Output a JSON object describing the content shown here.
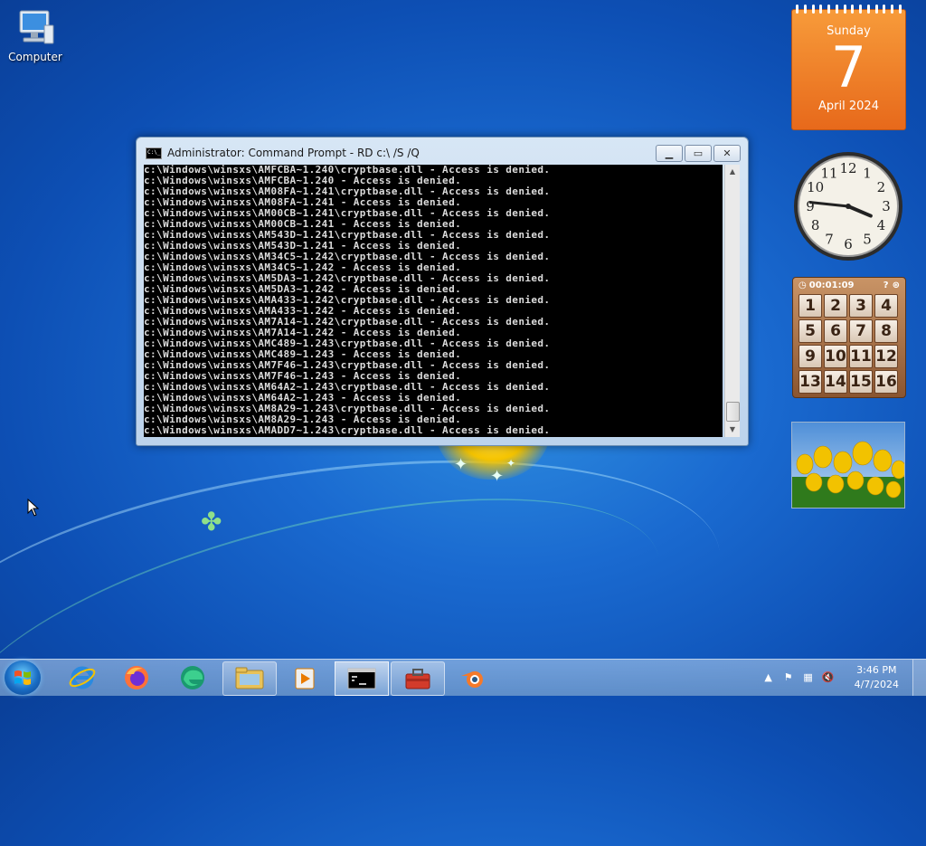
{
  "desktop": {
    "icons": [
      {
        "label": "Computer",
        "icon": "computer-icon"
      }
    ]
  },
  "cmd_window": {
    "title": "Administrator:  Command Prompt - RD  c:\\ /S /Q",
    "buttons": [
      "minimize",
      "maximize",
      "close"
    ],
    "lines": [
      "c:\\Windows\\winsxs\\AMFCBA~1.240\\cryptbase.dll - Access is denied.",
      "c:\\Windows\\winsxs\\AMFCBA~1.240 - Access is denied.",
      "c:\\Windows\\winsxs\\AM08FA~1.241\\cryptbase.dll - Access is denied.",
      "c:\\Windows\\winsxs\\AM08FA~1.241 - Access is denied.",
      "c:\\Windows\\winsxs\\AM00CB~1.241\\cryptbase.dll - Access is denied.",
      "c:\\Windows\\winsxs\\AM00CB~1.241 - Access is denied.",
      "c:\\Windows\\winsxs\\AM543D~1.241\\cryptbase.dll - Access is denied.",
      "c:\\Windows\\winsxs\\AM543D~1.241 - Access is denied.",
      "c:\\Windows\\winsxs\\AM34C5~1.242\\cryptbase.dll - Access is denied.",
      "c:\\Windows\\winsxs\\AM34C5~1.242 - Access is denied.",
      "c:\\Windows\\winsxs\\AM5DA3~1.242\\cryptbase.dll - Access is denied.",
      "c:\\Windows\\winsxs\\AM5DA3~1.242 - Access is denied.",
      "c:\\Windows\\winsxs\\AMA433~1.242\\cryptbase.dll - Access is denied.",
      "c:\\Windows\\winsxs\\AMA433~1.242 - Access is denied.",
      "c:\\Windows\\winsxs\\AM7A14~1.242\\cryptbase.dll - Access is denied.",
      "c:\\Windows\\winsxs\\AM7A14~1.242 - Access is denied.",
      "c:\\Windows\\winsxs\\AMC489~1.243\\cryptbase.dll - Access is denied.",
      "c:\\Windows\\winsxs\\AMC489~1.243 - Access is denied.",
      "c:\\Windows\\winsxs\\AM7F46~1.243\\cryptbase.dll - Access is denied.",
      "c:\\Windows\\winsxs\\AM7F46~1.243 - Access is denied.",
      "c:\\Windows\\winsxs\\AM64A2~1.243\\cryptbase.dll - Access is denied.",
      "c:\\Windows\\winsxs\\AM64A2~1.243 - Access is denied.",
      "c:\\Windows\\winsxs\\AM8A29~1.243\\cryptbase.dll - Access is denied.",
      "c:\\Windows\\winsxs\\AM8A29~1.243 - Access is denied.",
      "c:\\Windows\\winsxs\\AMADD7~1.243\\cryptbase.dll - Access is denied."
    ]
  },
  "gadgets": {
    "calendar": {
      "day": "Sunday",
      "date": "7",
      "month": "April 2024"
    },
    "clock": {
      "hour": 3,
      "minute": 46,
      "numbers": [
        "12",
        "1",
        "2",
        "3",
        "4",
        "5",
        "6",
        "7",
        "8",
        "9",
        "10",
        "11"
      ]
    },
    "puzzle": {
      "timer": "00:01:09",
      "tiles": [
        "1",
        "2",
        "3",
        "4",
        "5",
        "6",
        "7",
        "8",
        "9",
        "10",
        "11",
        "12",
        "13",
        "14",
        "15",
        "16"
      ]
    },
    "slideshow": {
      "subject": "yellow tulips"
    }
  },
  "taskbar": {
    "start": "start-orb",
    "items": [
      {
        "name": "internet-explorer",
        "state": "normal"
      },
      {
        "name": "firefox",
        "state": "normal"
      },
      {
        "name": "edge",
        "state": "normal"
      },
      {
        "name": "windows-explorer",
        "state": "pinned"
      },
      {
        "name": "media-player",
        "state": "normal"
      },
      {
        "name": "command-prompt",
        "state": "active"
      },
      {
        "name": "toolbox",
        "state": "pinned"
      },
      {
        "name": "blender",
        "state": "normal"
      }
    ],
    "tray": {
      "time": "3:46 PM",
      "date": "4/7/2024"
    }
  },
  "colors": {
    "desktop": "#1a6ad0",
    "calendar": "#ee7d2b",
    "console_bg": "#000000",
    "console_fg": "#dcdcdc"
  }
}
